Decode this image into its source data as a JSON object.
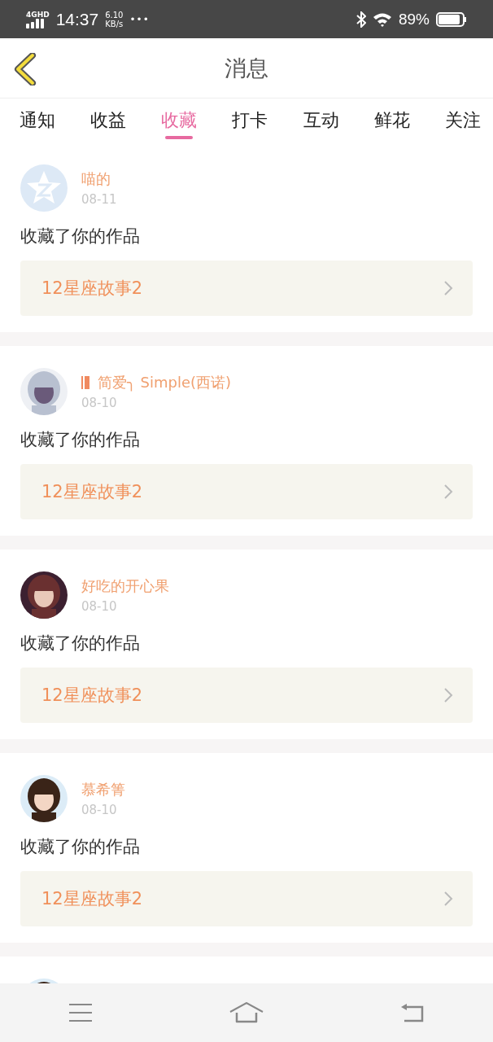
{
  "status_bar": {
    "network": "4GHD",
    "time": "14:37",
    "speed_value": "6.10",
    "speed_unit": "KB/s",
    "more": "•••",
    "battery": "89%"
  },
  "header": {
    "title": "消息"
  },
  "tabs": [
    {
      "label": "通知",
      "selected": false
    },
    {
      "label": "收益",
      "selected": false
    },
    {
      "label": "收藏",
      "selected": true
    },
    {
      "label": "打卡",
      "selected": false
    },
    {
      "label": "互动",
      "selected": false
    },
    {
      "label": "鲜花",
      "selected": false
    },
    {
      "label": "关注",
      "selected": false
    }
  ],
  "messages": [
    {
      "kind": "default",
      "name": "喵的",
      "vip": false,
      "date": "08-11",
      "text": "收藏了你的作品",
      "work": "12星座故事2"
    },
    {
      "kind": "picture",
      "name": "简爱╮ Simple(西诺)",
      "vip": true,
      "date": "08-10",
      "text": "收藏了你的作品",
      "work": "12星座故事2"
    },
    {
      "kind": "picture",
      "name": "好吃的开心果",
      "vip": false,
      "date": "08-10",
      "text": "收藏了你的作品",
      "work": "12星座故事2"
    },
    {
      "kind": "picture",
      "name": "慕希箐",
      "vip": false,
      "date": "08-10",
      "text": "收藏了你的作品",
      "work": "12星座故事2"
    }
  ]
}
